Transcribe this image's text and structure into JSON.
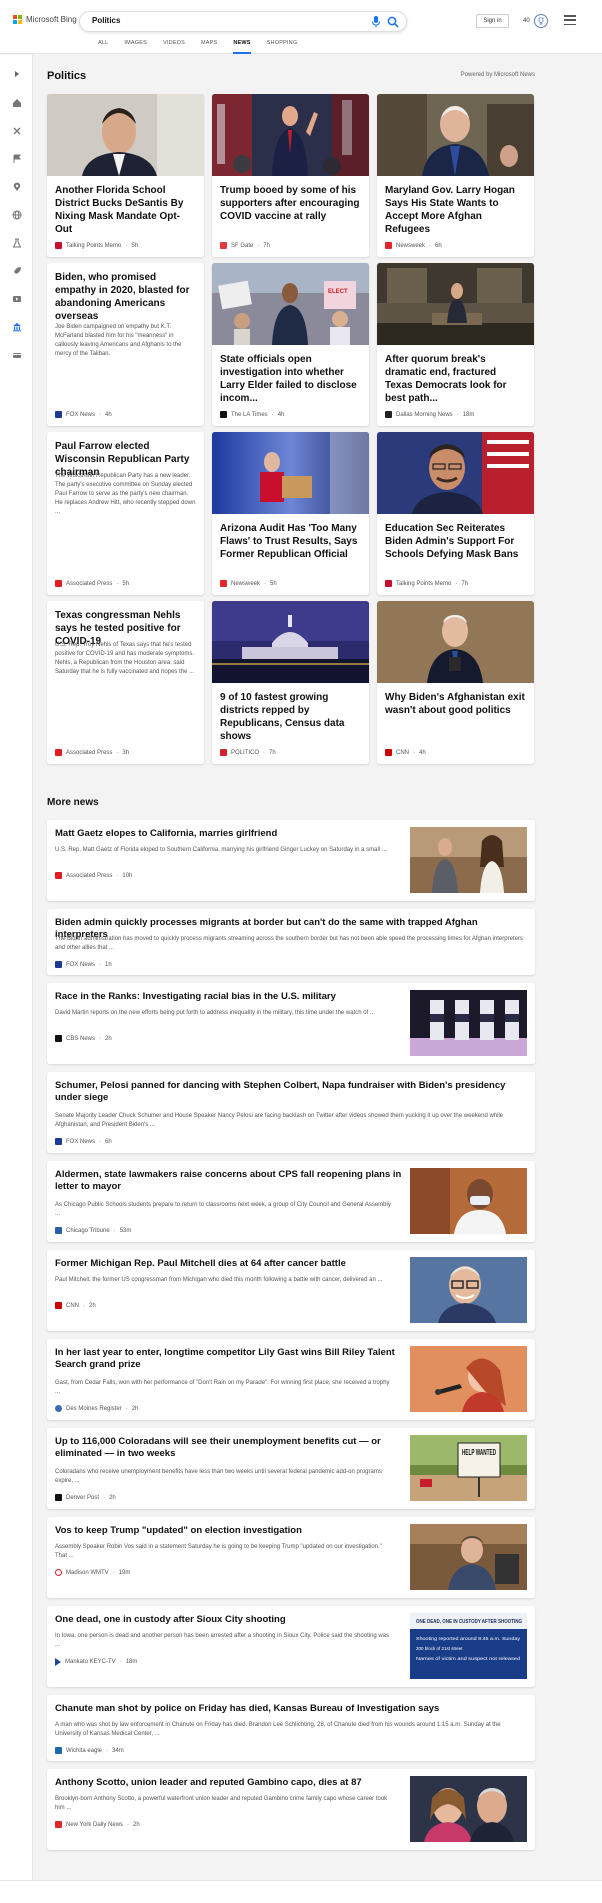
{
  "header": {
    "brand": "Microsoft Bing",
    "search_value": "Politics",
    "signin_label": "Sign in",
    "rewards_count": "40",
    "tabs": [
      {
        "label": "ALL"
      },
      {
        "label": "IMAGES"
      },
      {
        "label": "VIDEOS"
      },
      {
        "label": "MAPS"
      },
      {
        "label": "NEWS"
      },
      {
        "label": "SHOPPING"
      }
    ]
  },
  "main": {
    "title": "Politics",
    "powered_by": "Powered by Microsoft News",
    "cards": [
      {
        "title": "Another Florida School District Bucks DeSantis By Nixing Mask Mandate Opt-Out",
        "source": "Talking Points Memo",
        "time": "5h"
      },
      {
        "title": "Trump booed by some of his supporters after encouraging COVID vaccine at rally",
        "source": "SF Gate",
        "time": "7h"
      },
      {
        "title": "Maryland Gov. Larry Hogan Says His State Wants to Accept More Afghan Refugees",
        "source": "Newsweek",
        "time": "6h"
      },
      {
        "title": "Biden, who promised empathy in 2020, blasted for abandoning Americans overseas",
        "desc": "Joe Biden campaigned on empathy but K.T. McFarland blasted him for his \"meanness\" in callously leaving Americans and Afghanis to the mercy of the Taliban.",
        "source": "FOX News",
        "time": "4h"
      },
      {
        "title": "State officials open investigation into whether Larry Elder failed to disclose incom...",
        "source": "The LA Times",
        "time": "4h"
      },
      {
        "title": "After quorum break's dramatic end, fractured Texas Democrats look for best path...",
        "source": "Dallas Morning News",
        "time": "18m"
      },
      {
        "title": "Paul Farrow elected Wisconsin Republican Party chairman",
        "desc": "The Wisconsin Republican Party has a new leader. The party's executive committee on Sunday elected Paul Farrow to serve as the party's new chairman. He replaces Andrew Hitt, who recently stepped down ...",
        "source": "Associated Press",
        "time": "5h"
      },
      {
        "title": "Arizona Audit Has 'Too Many Flaws' to Trust Results, Says Former Republican Official",
        "source": "Newsweek",
        "time": "5h"
      },
      {
        "title": "Education Sec Reiterates Biden Admin's Support For Schools Defying Mask Bans",
        "source": "Talking Points Memo",
        "time": "7h"
      },
      {
        "title": "Texas congressman Nehls says he tested positive for COVID-19",
        "desc": "U.S. Rep. Troy Nehls of Texas says that he's tested positive for COVID-19 and has moderate symptoms. Nehls, a Republican from the Houston area, said Saturday that he is fully vaccinated and hopes the ...",
        "source": "Associated Press",
        "time": "3h"
      },
      {
        "title": "9 of 10 fastest growing districts repped by Republicans, Census data shows",
        "source": "POLITICO",
        "time": "7h"
      },
      {
        "title": "Why Biden's Afghanistan exit wasn't about good politics",
        "source": "CNN",
        "time": "4h"
      }
    ],
    "more_news_title": "More news",
    "more_news": [
      {
        "title": "Matt Gaetz elopes to California, marries girlfriend",
        "desc": "U.S. Rep. Matt Gaetz of Florida eloped to Southern California, marrying his girlfriend Ginger Luckey on Saturday in a small ...",
        "source": "Associated Press",
        "time": "10h"
      },
      {
        "title": "Biden admin quickly processes migrants at border but can't do the same with trapped Afghan interpreters",
        "desc": "The Biden administration has moved to quickly process migrants streaming across the southern border but has not been able speed the processing times for Afghan interpreters and other allies that ...",
        "source": "FOX News",
        "time": "1h"
      },
      {
        "title": "Race in the Ranks: Investigating racial bias in the U.S. military",
        "desc": "David Martin reports on the new efforts being put forth to address inequality in the military, this time under the watch of ...",
        "source": "CBS News",
        "time": "2h"
      },
      {
        "title": "Schumer, Pelosi panned for dancing with Stephen Colbert, Napa fundraiser with Biden's presidency under siege",
        "desc": "Senate Majority Leader Chuck Schumer and House Speaker Nancy Pelosi are facing backlash on Twitter after videos showed them yucking it up over the weekend while Afghanistan, and President Biden's ...",
        "source": "FOX News",
        "time": "6h"
      },
      {
        "title": "Aldermen, state lawmakers raise concerns about CPS fall reopening plans in letter to mayor",
        "desc": "As Chicago Public Schools students prepare to return to classrooms next week, a group of City Council and General Assembly ...",
        "source": "Chicago Tribune",
        "time": "53m"
      },
      {
        "title": "Former Michigan Rep. Paul Mitchell dies at 64 after cancer battle",
        "desc": "Paul Mitchell, the former US congressman from Michigan who died this month following a battle with cancer, delivered an ...",
        "source": "CNN",
        "time": "2h"
      },
      {
        "title": "In her last year to enter, longtime competitor Lily Gast wins Bill Riley Talent Search grand prize",
        "desc": "Gast, from Cedar Falls, won with her performance of \"Don't Rain on my Parade\". For winning first place, she received a trophy ...",
        "source": "Des Moines Register",
        "time": "2h"
      },
      {
        "title": "Up to 116,000 Coloradans will see their unemployment benefits cut — or eliminated — in two weeks",
        "desc": "Coloradans who receive unemployment benefits have less than two weeks until several federal pandemic add-on programs expire, ...",
        "source": "Denver Post",
        "time": "2h"
      },
      {
        "title": "Vos to keep Trump \"updated\" on election investigation",
        "desc": "Assembly Speaker Robin Vos said in a statement Saturday he is going to be keeping Trump \"updated on our investigation.\" That ...",
        "source": "Madison WMTV",
        "time": "19m"
      },
      {
        "title": "One dead, one in custody after Sioux City shooting",
        "desc": "In Iowa, one person is dead and another person has been arrested after a shooting in Sioux City. Police said the shooting was ...",
        "source": "Mankato KEYC-TV",
        "time": "18m"
      },
      {
        "title": "Chanute man shot by police on Friday has died, Kansas Bureau of Investigation says",
        "desc": "A man who was shot by law enforcement in Chanute on Friday has died. Brandon Lee Schlichting, 28, of Chanute died from his wounds around 1:15 a.m. Sunday at the University of Kansas Medical Center, ...",
        "source": "Wichita eagle",
        "time": "34m"
      },
      {
        "title": "Anthony Scotto, union leader and reputed Gambino capo, dies at 87",
        "desc": "Brooklyn-born Anthony Scotto, a powerful waterfront union leader and reputed Gambino crime family capo whose career took him ...",
        "source": "New York Daily News",
        "time": "2h"
      }
    ],
    "thumb_texts": {
      "help_wanted": "HELP WANTED",
      "sioux_headline": "ONE DEAD, ONE IN CUSTODY AFTER SHOOTING",
      "sioux_b1": "Shooting reported around 9:45 a.m. Sunday",
      "sioux_b2": "200 block of 21st street",
      "sioux_b3": "Names of victim and suspect not released"
    }
  },
  "colors": {
    "accent": "#1a73e8",
    "bg": "#f3f3f3",
    "card": "#ffffff"
  }
}
